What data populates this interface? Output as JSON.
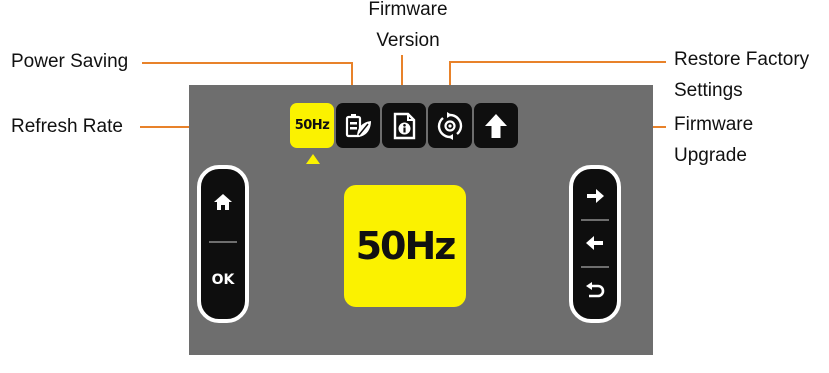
{
  "callouts": {
    "firmware_version": [
      "Firmware",
      "Version"
    ],
    "power_saving": "Power Saving",
    "restore_factory": [
      "Restore Factory",
      "Settings"
    ],
    "refresh_rate": "Refresh Rate",
    "firmware_upgrade": [
      "Firmware",
      "Upgrade"
    ]
  },
  "menu": {
    "tabs": [
      {
        "label": "50Hz",
        "icon": "refresh-rate",
        "active": true
      },
      {
        "label": "",
        "icon": "power-saving-icon",
        "active": false
      },
      {
        "label": "",
        "icon": "firmware-info-icon",
        "active": false
      },
      {
        "label": "",
        "icon": "restore-icon",
        "active": false
      },
      {
        "label": "",
        "icon": "upload-arrow-icon",
        "active": false
      }
    ]
  },
  "display": {
    "value": "50Hz"
  },
  "left_buttons": {
    "home_icon": "home-icon",
    "ok_label": "OK"
  },
  "right_buttons": {
    "next_icon": "arrow-right-icon",
    "prev_icon": "arrow-left-icon",
    "back_icon": "return-icon"
  },
  "colors": {
    "accent": "#fbf200",
    "leader": "#e8822a",
    "screen": "#6e6e6e",
    "button": "#0f0f0f"
  }
}
